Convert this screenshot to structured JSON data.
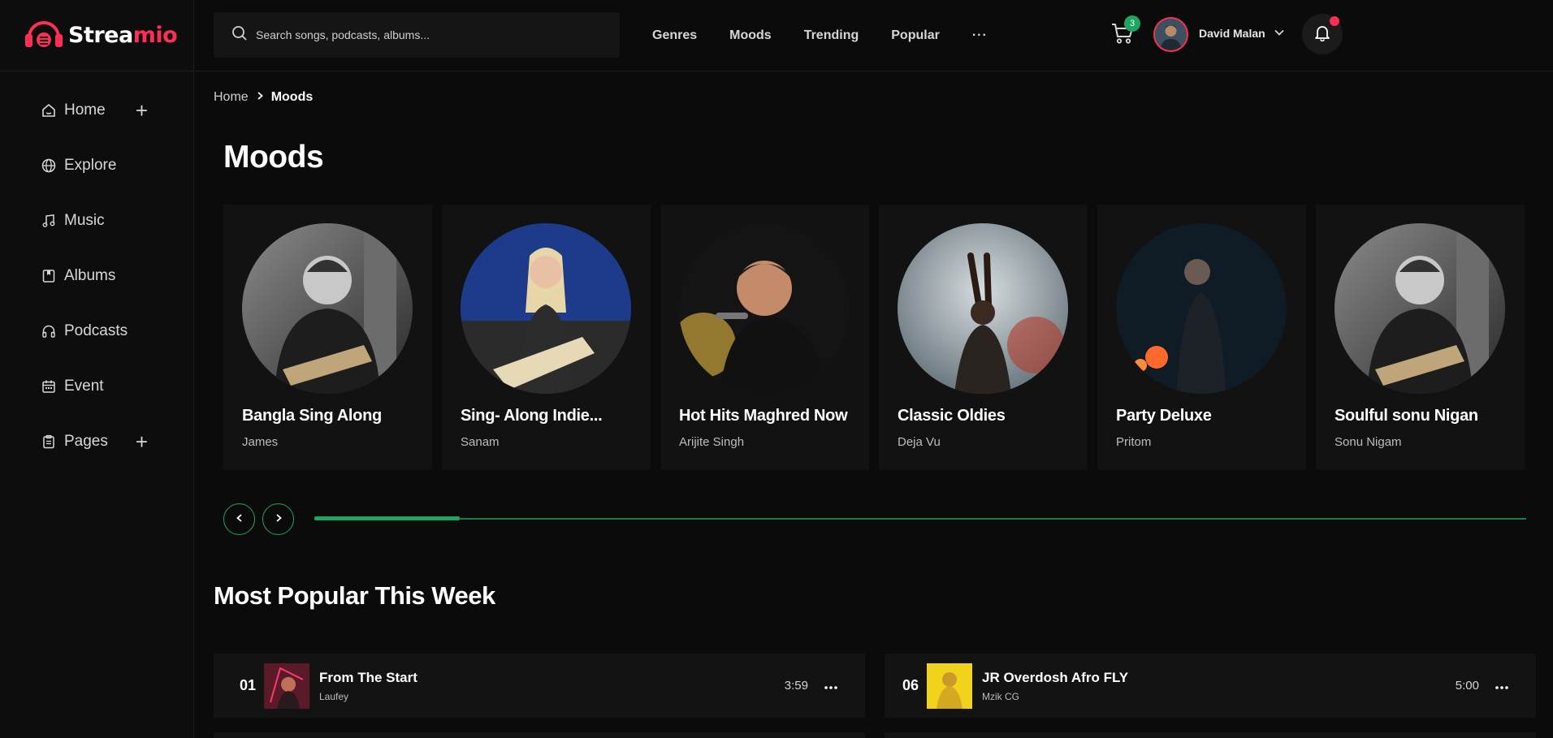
{
  "brand": {
    "name_main": "Strea",
    "name_accent": "mio",
    "accent_color": "#ff2e55",
    "secondary_color": "#1fa562"
  },
  "sidebar": {
    "items": [
      {
        "label": "Home",
        "icon": "home-icon",
        "expandable": true
      },
      {
        "label": "Explore",
        "icon": "globe-icon",
        "expandable": false
      },
      {
        "label": "Music",
        "icon": "music-note-icon",
        "expandable": false
      },
      {
        "label": "Albums",
        "icon": "album-icon",
        "expandable": false
      },
      {
        "label": "Podcasts",
        "icon": "headphones-icon",
        "expandable": false
      },
      {
        "label": "Event",
        "icon": "calendar-icon",
        "expandable": false
      },
      {
        "label": "Pages",
        "icon": "clipboard-icon",
        "expandable": true
      }
    ]
  },
  "header": {
    "search_placeholder": "Search songs, podcasts, albums...",
    "nav": [
      "Genres",
      "Moods",
      "Trending",
      "Popular"
    ],
    "more_label": "···",
    "cart_count": "3",
    "user_name": "David Malan"
  },
  "breadcrumb": {
    "home": "Home",
    "current": "Moods"
  },
  "page_title": "Moods",
  "moods": [
    {
      "title": "Bangla Sing Along",
      "artist": "James"
    },
    {
      "title": "Sing- Along Indie...",
      "artist": "Sanam"
    },
    {
      "title": "Hot Hits Maghred Now",
      "artist": "Arijite Singh"
    },
    {
      "title": "Classic Oldies",
      "artist": "Deja Vu"
    },
    {
      "title": "Party Deluxe",
      "artist": "Pritom"
    },
    {
      "title": "Soulful sonu Nigan",
      "artist": "Sonu Nigam"
    }
  ],
  "carousel": {
    "progress": 0.12
  },
  "popular": {
    "title": "Most Popular This Week",
    "tracks": [
      {
        "num": "01",
        "title": "From The Start",
        "artist": "Laufey",
        "duration": "3:59"
      },
      {
        "num": "06",
        "title": "JR Overdosh Afro FLY",
        "artist": "Mzik CG",
        "duration": "5:00"
      }
    ]
  }
}
